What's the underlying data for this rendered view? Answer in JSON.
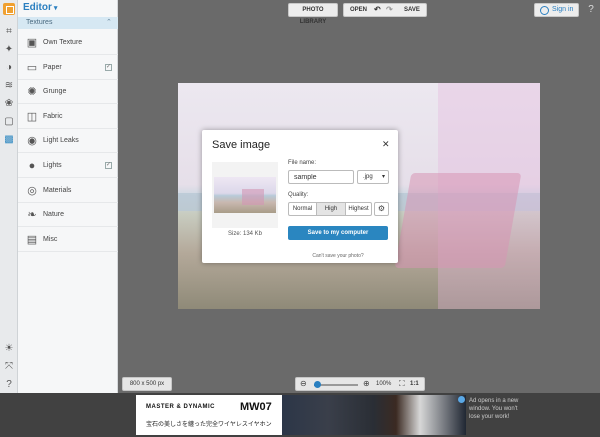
{
  "editor": {
    "title": "Editor",
    "section": "Textures",
    "items": [
      {
        "label": "Own Texture",
        "icon": "image-plus-icon",
        "checked": false,
        "has_checkbox": false
      },
      {
        "label": "Paper",
        "icon": "paper-icon",
        "checked": true,
        "has_checkbox": true
      },
      {
        "label": "Grunge",
        "icon": "splat-icon",
        "checked": false,
        "has_checkbox": false
      },
      {
        "label": "Fabric",
        "icon": "fabric-icon",
        "checked": false,
        "has_checkbox": false
      },
      {
        "label": "Light Leaks",
        "icon": "camera-icon",
        "checked": false,
        "has_checkbox": false
      },
      {
        "label": "Lights",
        "icon": "bulb-icon",
        "checked": true,
        "has_checkbox": true
      },
      {
        "label": "Materials",
        "icon": "materials-icon",
        "checked": false,
        "has_checkbox": false
      },
      {
        "label": "Nature",
        "icon": "leaf-icon",
        "checked": false,
        "has_checkbox": false
      },
      {
        "label": "Misc",
        "icon": "misc-icon",
        "checked": false,
        "has_checkbox": false
      }
    ]
  },
  "toolbar": {
    "photo_library": "PHOTO LIBRARY",
    "open": "OPEN",
    "save": "SAVE",
    "sign_in": "Sign in",
    "help": "?"
  },
  "canvas": {
    "size_label": "800 x 500 px",
    "zoom_percent": "100%",
    "one_to_one": "1:1"
  },
  "dialog": {
    "title": "Save image",
    "file_name_label": "File name:",
    "file_name_value": "sample",
    "format": ".jpg",
    "quality_label": "Quality:",
    "quality_options": [
      "Normal",
      "High",
      "Highest"
    ],
    "selected_quality": "High",
    "size_text": "Size: 134 Kb",
    "save_button": "Save to my computer",
    "cant_save": "Can't save your photo?"
  },
  "ad": {
    "brand": "MASTER & DYNAMIC",
    "model": "MW07",
    "tagline": "宝石の美しさを纏った完全ワイヤレスイヤホン",
    "note": "Ad opens in a new window. You won't lose your work!"
  },
  "colors": {
    "accent": "#2a86c0",
    "logo": "#f0a030",
    "workspace": "#6a6a6a"
  }
}
